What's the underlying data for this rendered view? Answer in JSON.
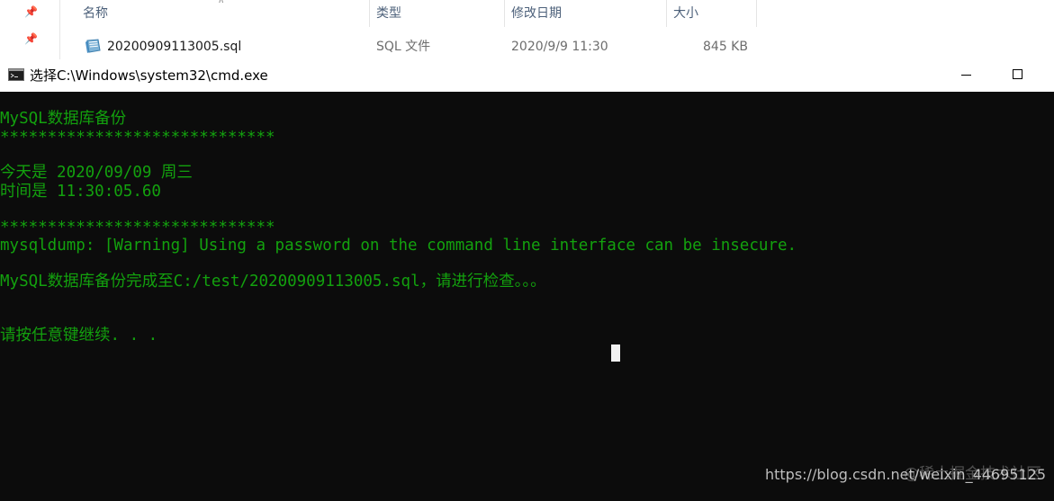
{
  "explorer": {
    "columns": {
      "name": "名称",
      "type": "类型",
      "modified": "修改日期",
      "size": "大小"
    },
    "file": {
      "name": "20200909113005.sql",
      "type": "SQL 文件",
      "modified": "2020/9/9 11:30",
      "size": "845 KB"
    }
  },
  "cmd": {
    "title": "选择C:\\Windows\\system32\\cmd.exe",
    "lines": [
      "MySQL数据库备份",
      "*****************************",
      "",
      "今天是 2020/09/09 周三",
      "时间是 11:30:05.60",
      "",
      "*****************************",
      "mysqldump: [Warning] Using a password on the command line interface can be insecure.",
      "",
      "MySQL数据库备份完成至C:/test/20200909113005.sql，请进行检查。。。",
      "",
      "",
      "请按任意键继续. . ."
    ]
  },
  "watermark": {
    "url": "https://blog.csdn.net/weixin_44695125",
    "site": "@稀土掘金技术社区"
  },
  "colors": {
    "console_bg": "#0c0c0c",
    "console_text": "#13a10e",
    "cursor": "#f2f2f2"
  }
}
